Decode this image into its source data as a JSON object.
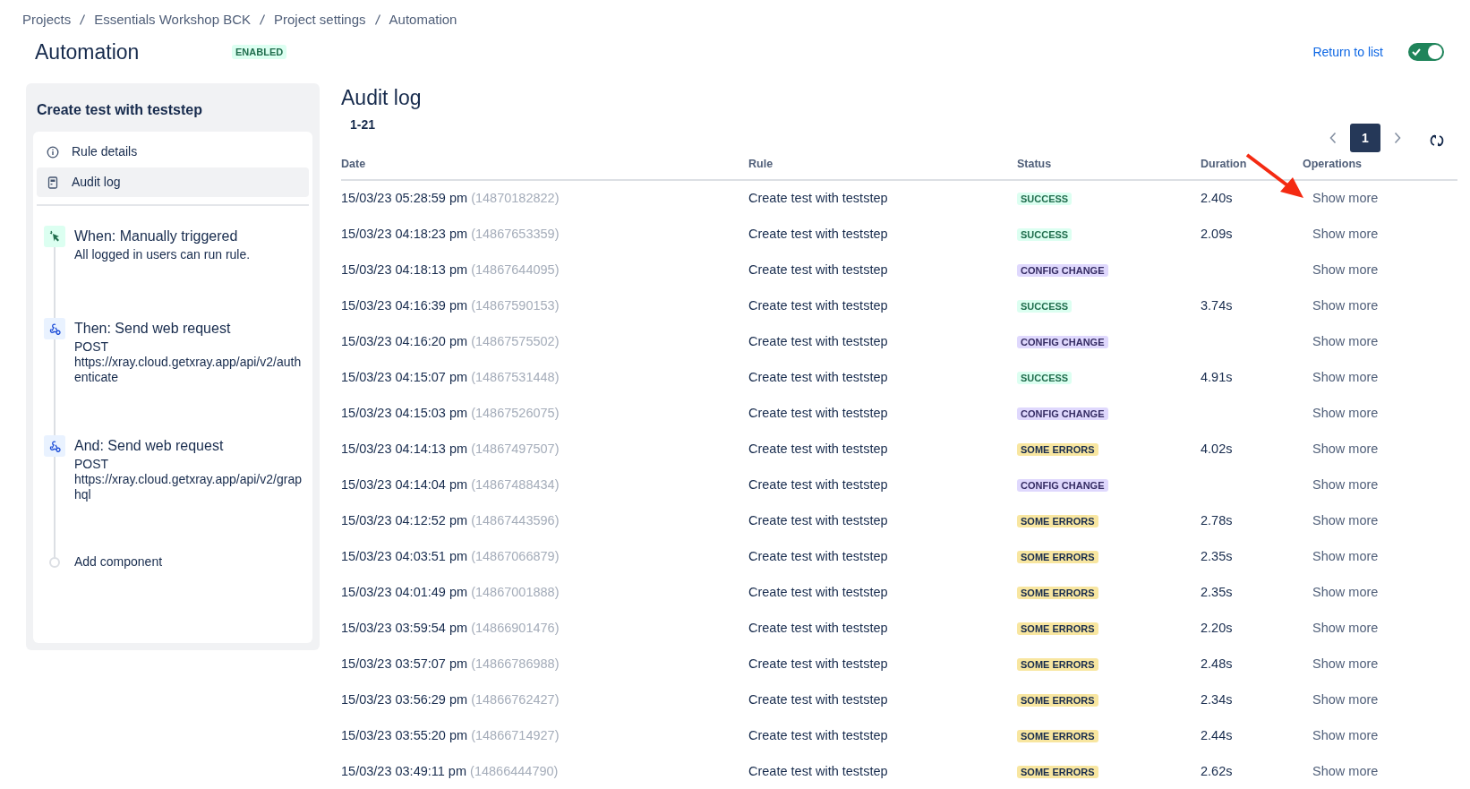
{
  "breadcrumbs": [
    "Projects",
    "Essentials Workshop BCK",
    "Project settings",
    "Automation"
  ],
  "header": {
    "title": "Automation",
    "badge": "ENABLED",
    "return_link": "Return to list",
    "toggle_on": true
  },
  "sidebar": {
    "title": "Create test with teststep",
    "nav": [
      {
        "label": "Rule details",
        "kind": "info",
        "selected": false
      },
      {
        "label": "Audit log",
        "kind": "log",
        "selected": true
      }
    ],
    "steps": [
      {
        "kind": "trigger",
        "title": "When: Manually triggered",
        "lines": [
          "All logged in users can run rule."
        ]
      },
      {
        "kind": "action",
        "title": "Then: Send web request",
        "lines": [
          "POST",
          "https://xray.cloud.getxray.app/api/v2/authenticate"
        ]
      },
      {
        "kind": "action",
        "title": "And: Send web request",
        "lines": [
          "POST",
          "https://xray.cloud.getxray.app/api/v2/graphql"
        ]
      },
      {
        "kind": "add",
        "title": "Add component"
      }
    ]
  },
  "audit": {
    "title": "Audit log",
    "range": "1-21",
    "pagination": {
      "pages": [
        {
          "label": "1",
          "selected": true
        }
      ]
    },
    "columns": [
      "Date",
      "Rule",
      "Status",
      "Duration",
      "Operations"
    ],
    "rows": [
      {
        "date": "15/03/23 05:28:59 pm",
        "id": "(14870182822)",
        "rule": "Create test with teststep",
        "status": {
          "label": "SUCCESS",
          "kind": "success"
        },
        "duration": "2.40s",
        "operation": "Show more"
      },
      {
        "date": "15/03/23 04:18:23 pm",
        "id": "(14867653359)",
        "rule": "Create test with teststep",
        "status": {
          "label": "SUCCESS",
          "kind": "success"
        },
        "duration": "2.09s",
        "operation": "Show more"
      },
      {
        "date": "15/03/23 04:18:13 pm",
        "id": "(14867644095)",
        "rule": "Create test with teststep",
        "status": {
          "label": "CONFIG CHANGE",
          "kind": "config"
        },
        "operation": "Show more"
      },
      {
        "date": "15/03/23 04:16:39 pm",
        "id": "(14867590153)",
        "rule": "Create test with teststep",
        "status": {
          "label": "SUCCESS",
          "kind": "success"
        },
        "duration": "3.74s",
        "operation": "Show more"
      },
      {
        "date": "15/03/23 04:16:20 pm",
        "id": "(14867575502)",
        "rule": "Create test with teststep",
        "status": {
          "label": "CONFIG CHANGE",
          "kind": "config"
        },
        "operation": "Show more"
      },
      {
        "date": "15/03/23 04:15:07 pm",
        "id": "(14867531448)",
        "rule": "Create test with teststep",
        "status": {
          "label": "SUCCESS",
          "kind": "success"
        },
        "duration": "4.91s",
        "operation": "Show more"
      },
      {
        "date": "15/03/23 04:15:03 pm",
        "id": "(14867526075)",
        "rule": "Create test with teststep",
        "status": {
          "label": "CONFIG CHANGE",
          "kind": "config"
        },
        "operation": "Show more"
      },
      {
        "date": "15/03/23 04:14:13 pm",
        "id": "(14867497507)",
        "rule": "Create test with teststep",
        "status": {
          "label": "SOME ERRORS",
          "kind": "errors"
        },
        "duration": "4.02s",
        "operation": "Show more"
      },
      {
        "date": "15/03/23 04:14:04 pm",
        "id": "(14867488434)",
        "rule": "Create test with teststep",
        "status": {
          "label": "CONFIG CHANGE",
          "kind": "config"
        },
        "operation": "Show more"
      },
      {
        "date": "15/03/23 04:12:52 pm",
        "id": "(14867443596)",
        "rule": "Create test with teststep",
        "status": {
          "label": "SOME ERRORS",
          "kind": "errors"
        },
        "duration": "2.78s",
        "operation": "Show more"
      },
      {
        "date": "15/03/23 04:03:51 pm",
        "id": "(14867066879)",
        "rule": "Create test with teststep",
        "status": {
          "label": "SOME ERRORS",
          "kind": "errors"
        },
        "duration": "2.35s",
        "operation": "Show more"
      },
      {
        "date": "15/03/23 04:01:49 pm",
        "id": "(14867001888)",
        "rule": "Create test with teststep",
        "status": {
          "label": "SOME ERRORS",
          "kind": "errors"
        },
        "duration": "2.35s",
        "operation": "Show more"
      },
      {
        "date": "15/03/23 03:59:54 pm",
        "id": "(14866901476)",
        "rule": "Create test with teststep",
        "status": {
          "label": "SOME ERRORS",
          "kind": "errors"
        },
        "duration": "2.20s",
        "operation": "Show more"
      },
      {
        "date": "15/03/23 03:57:07 pm",
        "id": "(14866786988)",
        "rule": "Create test with teststep",
        "status": {
          "label": "SOME ERRORS",
          "kind": "errors"
        },
        "duration": "2.48s",
        "operation": "Show more"
      },
      {
        "date": "15/03/23 03:56:29 pm",
        "id": "(14866762427)",
        "rule": "Create test with teststep",
        "status": {
          "label": "SOME ERRORS",
          "kind": "errors"
        },
        "duration": "2.34s",
        "operation": "Show more"
      },
      {
        "date": "15/03/23 03:55:20 pm",
        "id": "(14866714927)",
        "rule": "Create test with teststep",
        "status": {
          "label": "SOME ERRORS",
          "kind": "errors"
        },
        "duration": "2.44s",
        "operation": "Show more"
      },
      {
        "date": "15/03/23 03:49:11 pm",
        "id": "(14866444790)",
        "rule": "Create test with teststep",
        "status": {
          "label": "SOME ERRORS",
          "kind": "errors"
        },
        "duration": "2.62s",
        "operation": "Show more"
      }
    ]
  }
}
